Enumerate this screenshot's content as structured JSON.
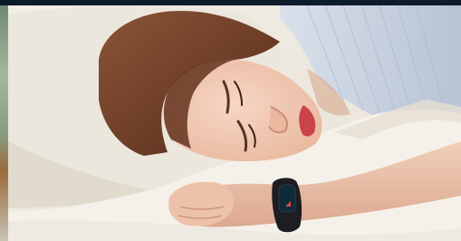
{
  "image": {
    "subject": "sleeping-woman-with-fitness-tracker",
    "colors": {
      "sheet": "#f4f0e8",
      "pillow": "#ebe6dc",
      "skin": "#efc9b4",
      "hair": "#6b3b26",
      "shirt": "#c9d4e4",
      "watch_band": "#1d1d22",
      "watch_screen": "#0f2a3a",
      "watch_accent": "#7fd8ff",
      "frame": "#0c1c2a"
    },
    "icons": [
      "fitness-tracker-icon"
    ]
  }
}
